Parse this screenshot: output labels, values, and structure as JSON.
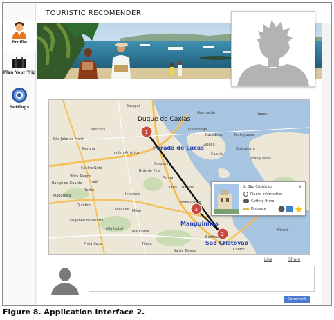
{
  "app": {
    "title": "TOURISTIC RECOMENDER"
  },
  "sidebar": {
    "items": [
      {
        "label": "Profile",
        "icon": "user-icon"
      },
      {
        "label": "Plan Your Trip",
        "icon": "suitcase-icon"
      },
      {
        "label": "Settings",
        "icon": "settings-icon"
      }
    ]
  },
  "map": {
    "places": [
      "Duque de Caxias",
      "Parada de Lucas",
      "Manguinhos",
      "São Cristóvão",
      "Sarapuí",
      "Gramacho",
      "São João de Meriti",
      "Nilópolis",
      "Pavuna",
      "Jardim América",
      "Cordovil",
      "Brás de Pina",
      "Penha",
      "Ramos",
      "Olaria",
      "Bonsucesso",
      "Inhaúma",
      "Piedade",
      "Méier",
      "Vila Isabel",
      "Maracanã",
      "Tijuca",
      "Benfica",
      "Centro",
      "Praia Seca",
      "Santa Teresa",
      "Engenho de Dentro",
      "Galeão",
      "Itaoca",
      "Niterói",
      "Portuguesa",
      "Guanabara",
      "Tubiacanga",
      "Bancários",
      "Cacuia",
      "Pitangueiras",
      "Coelho Neto",
      "Irajá",
      "Madureira",
      "Vista Alegre",
      "Bangu da Guarda",
      "Quintino",
      "Rocha"
    ],
    "markers": [
      "1",
      "2",
      "3"
    ],
    "route_color": "#111111"
  },
  "popup": {
    "title": "2. São Cristóvão",
    "close": "x",
    "rows": [
      "Places information",
      "Getting there",
      "Distance"
    ]
  },
  "actions": {
    "like": "Like",
    "share": "Share",
    "comment": "Comment"
  },
  "caption": "Figure 8. Application Interface 2."
}
